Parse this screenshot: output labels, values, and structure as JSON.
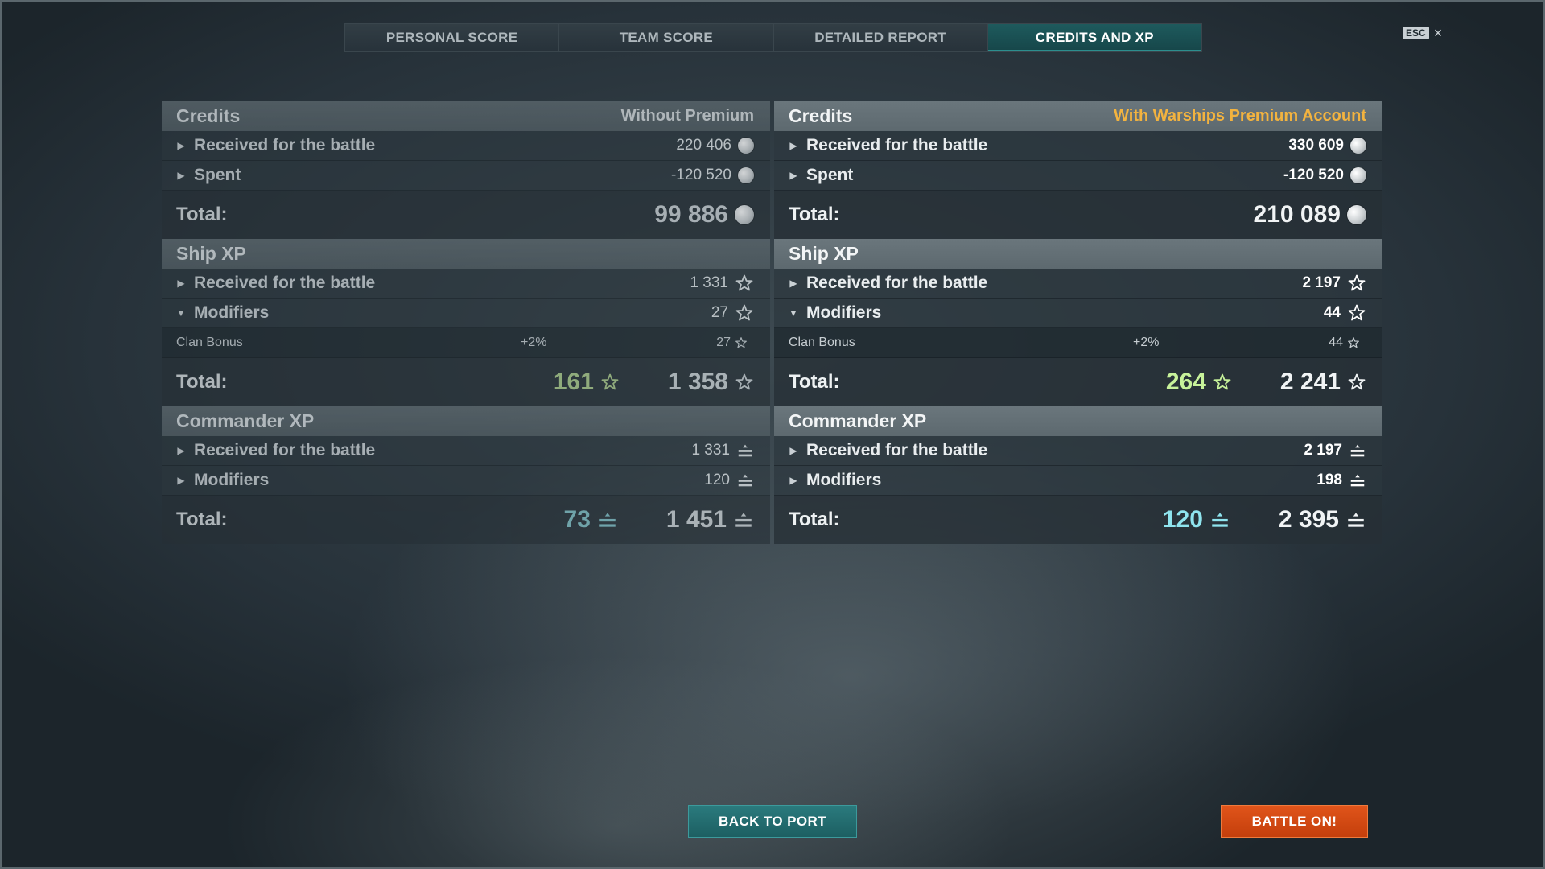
{
  "tabs": [
    {
      "label": "PERSONAL SCORE",
      "active": false
    },
    {
      "label": "TEAM SCORE",
      "active": false
    },
    {
      "label": "DETAILED REPORT",
      "active": false
    },
    {
      "label": "CREDITS AND XP",
      "active": true
    }
  ],
  "esc": {
    "key": "ESC",
    "close": "×"
  },
  "left": {
    "credits": {
      "title": "Credits",
      "note": "Without Premium",
      "received_label": "Received for the battle",
      "received_value": "220 406",
      "spent_label": "Spent",
      "spent_value": "-120 520",
      "total_label": "Total:",
      "total_value": "99 886"
    },
    "ship_xp": {
      "title": "Ship XP",
      "received_label": "Received for the battle",
      "received_value": "1 331",
      "modifiers_label": "Modifiers",
      "modifiers_value": "27",
      "clan_label": "Clan Bonus",
      "clan_pct": "+2%",
      "clan_value": "27",
      "total_label": "Total:",
      "total_free": "161",
      "total_value": "1 358"
    },
    "commander_xp": {
      "title": "Commander XP",
      "received_label": "Received for the battle",
      "received_value": "1 331",
      "modifiers_label": "Modifiers",
      "modifiers_value": "120",
      "total_label": "Total:",
      "total_free": "73",
      "total_value": "1 451"
    }
  },
  "right": {
    "credits": {
      "title": "Credits",
      "note": "With Warships Premium Account",
      "received_label": "Received for the battle",
      "received_value": "330 609",
      "spent_label": "Spent",
      "spent_value": "-120 520",
      "total_label": "Total:",
      "total_value": "210 089"
    },
    "ship_xp": {
      "title": "Ship XP",
      "received_label": "Received for the battle",
      "received_value": "2 197",
      "modifiers_label": "Modifiers",
      "modifiers_value": "44",
      "clan_label": "Clan Bonus",
      "clan_pct": "+2%",
      "clan_value": "44",
      "total_label": "Total:",
      "total_free": "264",
      "total_value": "2 241"
    },
    "commander_xp": {
      "title": "Commander XP",
      "received_label": "Received for the battle",
      "received_value": "2 197",
      "modifiers_label": "Modifiers",
      "modifiers_value": "198",
      "total_label": "Total:",
      "total_free": "120",
      "total_value": "2 395"
    }
  },
  "buttons": {
    "back_to_port": "BACK TO PORT",
    "battle_on": "BATTLE ON!"
  },
  "colors": {
    "premium_note": "#f3b33f",
    "free_xp": "#c7f29a",
    "free_commander_xp": "#8fe4ee",
    "back_to_port": "#1d5f62",
    "battle_on": "#c43f0c"
  },
  "icons": {
    "credits": "silver-coin-icon",
    "ship_xp": "star-icon",
    "commander_xp": "commander-xp-icon",
    "expand": "caret-right-icon",
    "collapse": "caret-down-icon"
  }
}
